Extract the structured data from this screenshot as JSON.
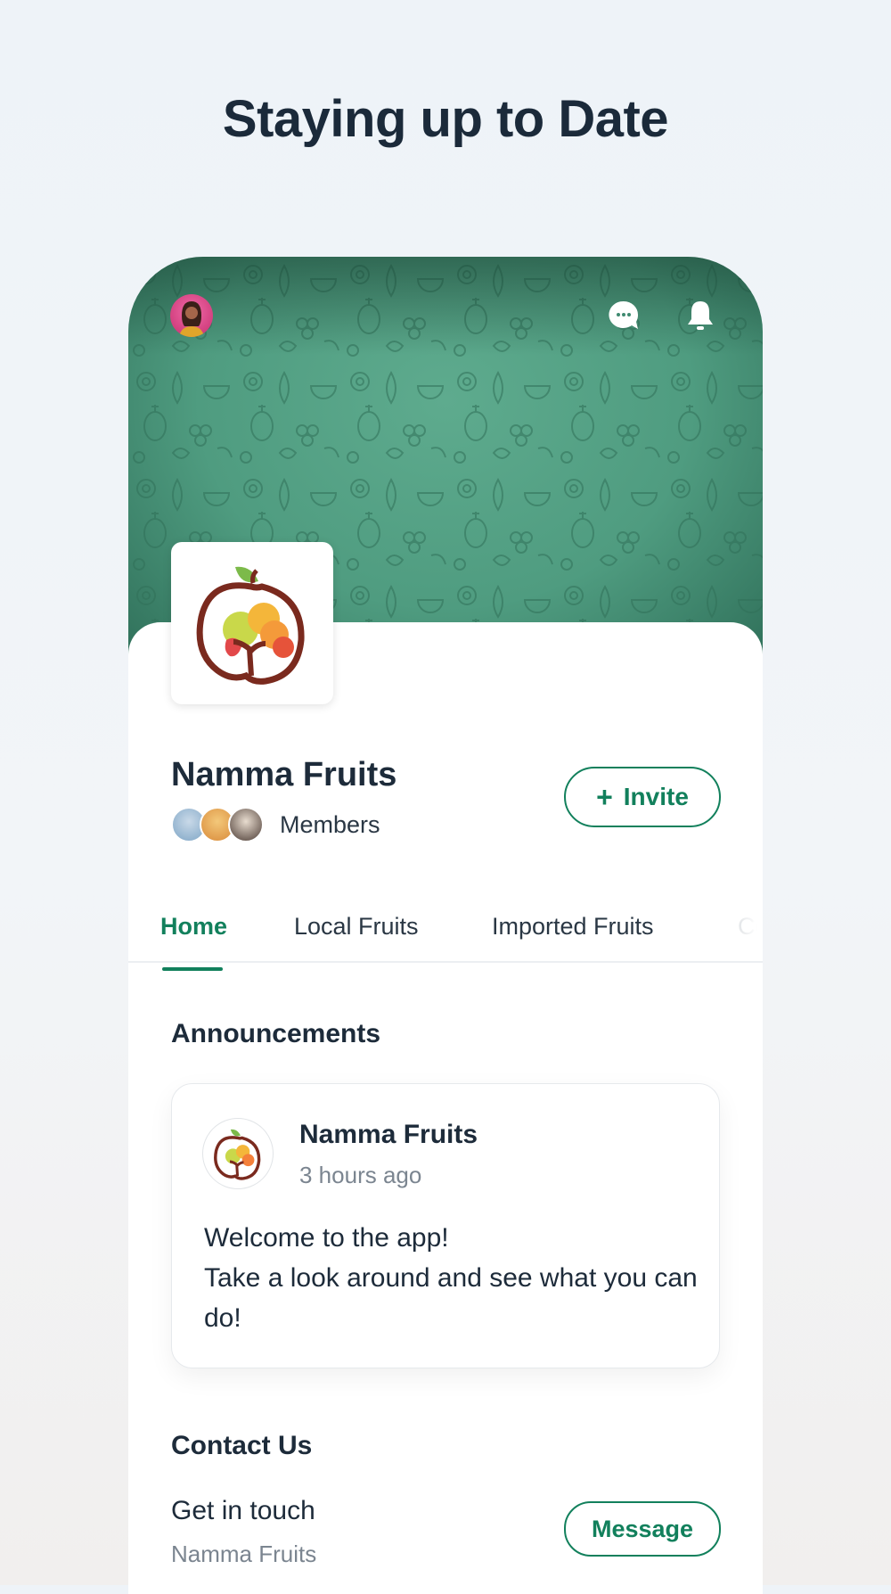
{
  "headline": "Staying up to Date",
  "group": {
    "name": "Namma Fruits",
    "members_label": "Members",
    "invite_label": "Invite"
  },
  "tabs": [
    {
      "label": "Home",
      "active": true
    },
    {
      "label": "Local Fruits",
      "active": false
    },
    {
      "label": "Imported Fruits",
      "active": false
    },
    {
      "label": "Co",
      "active": false
    }
  ],
  "announcements": {
    "title": "Announcements",
    "post": {
      "author": "Namma Fruits",
      "time": "3 hours ago",
      "body_line1": "Welcome to the app!",
      "body_line2": "Take a look around and see what you can do!"
    }
  },
  "contact": {
    "title": "Contact Us",
    "line1": "Get in touch",
    "line2": "Namma Fruits",
    "message_label": "Message"
  },
  "icons": {
    "chat": "chat-bubble-icon",
    "notifications": "bell-icon",
    "invite": "plus-icon"
  },
  "colors": {
    "accent": "#12805c",
    "cover": "#4f9c80",
    "text": "#1d2b3a",
    "muted": "#7b8590"
  }
}
